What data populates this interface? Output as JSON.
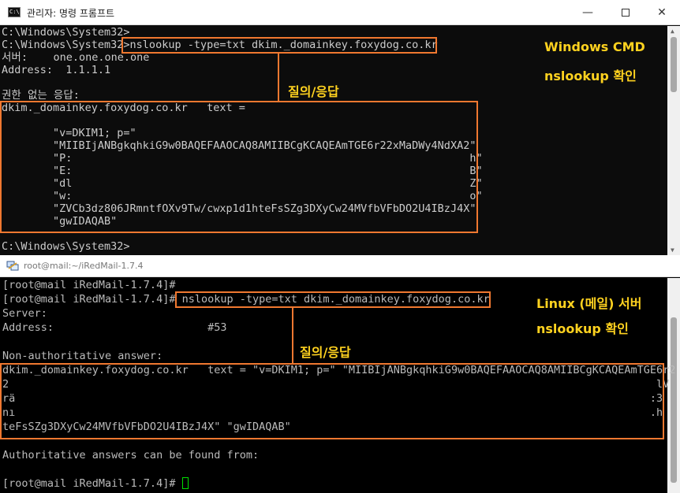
{
  "cmd": {
    "title": "관리자: 명령 프롬프트",
    "icon_text": "C:\\",
    "controls": {
      "minimize": "—",
      "close": "✕"
    },
    "lines": [
      "C:\\Windows\\System32>",
      "C:\\Windows\\System32>nslookup -type=txt dkim._domainkey.foxydog.co.kr",
      "서버:    one.one.one.one",
      "Address:  1.1.1.1",
      "",
      "권한 없는 응답:",
      "dkim._domainkey.foxydog.co.kr   text =",
      "",
      "        \"v=DKIM1; p=\"",
      "        \"MIIBIjANBgkqhkiG9w0BAQEFAAOCAQ8AMIIBCgKCAQEAmTGE6r22xMaDWy4NdXA2\"",
      "        \"P:                                                              h\"",
      "        \"E:                                                              B\"",
      "        \"dl                                                              Z\"",
      "        \"w:                                                              o\"",
      "        \"ZVCb3dz806JRmntfOXv9Tw/cwxp1d1hteFsSZg3DXyCw24MVfbVFbDO2U4IBzJ4X\"",
      "        \"gwIDAQAB\"",
      "",
      "C:\\Windows\\System32>"
    ],
    "annotation_query": "질의/응답",
    "annotation_title_1": "Windows CMD",
    "annotation_title_2": "nslookup 확인"
  },
  "putty": {
    "title": "root@mail:~/iRedMail-1.7.4",
    "lines": [
      "[root@mail iRedMail-1.7.4]#",
      "[root@mail iRedMail-1.7.4]# nslookup -type=txt dkim._domainkey.foxydog.co.kr",
      "Server:",
      "Address:                        #53",
      "",
      "Non-authoritative answer:",
      "dkim._domainkey.foxydog.co.kr   text = \"v=DKIM1; p=\" \"MIIBIjANBgkqhkiG9w0BAQEFAAOCAQ8AMIIBCgKCAQEAmTGE6r2",
      "2                                                                                                     lV",
      "rä                                                                                                   :3",
      "nı                                                                                                   .h",
      "teFsSZg3DXyCw24MVfbVFbDO2U4IBzJ4X\" \"gwIDAQAB\"",
      "",
      "Authoritative answers can be found from:",
      "",
      "[root@mail iRedMail-1.7.4]# "
    ],
    "annotation_query": "질의/응답",
    "annotation_title_1": "Linux (메일) 서버",
    "annotation_title_2": "nslookup 확인"
  },
  "colors": {
    "annotation_box": "#f07830",
    "annotation_text": "#ffd21f",
    "cursor": "#00e000"
  }
}
